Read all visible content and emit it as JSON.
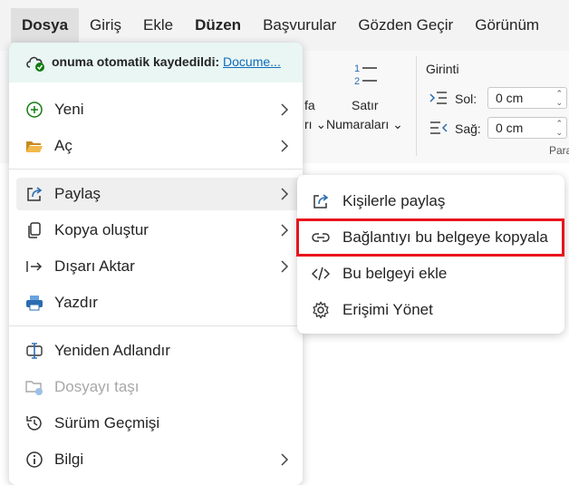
{
  "menubar": {
    "tabs": [
      "Dosya",
      "Giriş",
      "Ekle",
      "Düzen",
      "Başvurular",
      "Gözden Geçir",
      "Görünüm"
    ]
  },
  "ribbon": {
    "partial_a_top": "fa",
    "partial_a_bottom": "rı",
    "satir": "Satır",
    "numaralari": "Numaraları",
    "girinti": "Girinti",
    "sol_label": "Sol:",
    "sol_value": "0 cm",
    "sag_label": "Sağ:",
    "sag_value": "0 cm",
    "para_partial": "Para"
  },
  "autosave": {
    "text": "onuma otomatik kaydedildi:",
    "link": "Docume..."
  },
  "menu": {
    "yeni": "Yeni",
    "ac": "Aç",
    "paylas": "Paylaş",
    "kopya": "Kopya oluştur",
    "disari": "Dışarı Aktar",
    "yazdir": "Yazdır",
    "adlandir": "Yeniden Adlandır",
    "tasi": "Dosyayı taşı",
    "surum": "Sürüm Geçmişi",
    "bilgi": "Bilgi"
  },
  "submenu": {
    "kisiler": "Kişilerle paylaş",
    "baglanti": "Bağlantıyı bu belgeye kopyala",
    "ekle": "Bu belgeyi ekle",
    "erisim": "Erişimi Yönet"
  },
  "colors": {
    "highlight": "#e8141c",
    "link": "#0f6cbd",
    "new_icon": "#107c10",
    "folder_icon": "#e8a33d",
    "print_icon": "#2b6cb0"
  }
}
